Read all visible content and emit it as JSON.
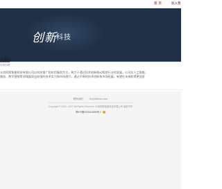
{
  "nav": {
    "home_label": "首 页",
    "join_label": "加入我"
  },
  "banner": {
    "logo_mark": "创新",
    "logo_text": "科技"
  },
  "section": {
    "title": "大事记",
    "subtitle": "发展历程",
    "body_lines": [
      "众尚阿斯智能科技有限公司以科技推广和应用服务为主，致力于通过技术创新推动相关行业的发展。公司在人工智能、",
      "服务、数字营销等领域展现出较强的技术实力和市场潜力，通过不断的技术创新和市场拓展，有望在未来取得更加显"
    ]
  },
  "footer": {
    "contact_label": "联系我们",
    "email": "hr@hbbxcn.com",
    "copyright": "Copyright © 2024 - 2027 All Rights Reserved. 众尚阿斯智能科技有限公司 版权所有",
    "beian": "豫ICP备2024104880号-1"
  },
  "colors": {
    "accent": "#d9534f",
    "banner_bg": "#1f2f45",
    "footer_bg": "#f5f5f5"
  }
}
